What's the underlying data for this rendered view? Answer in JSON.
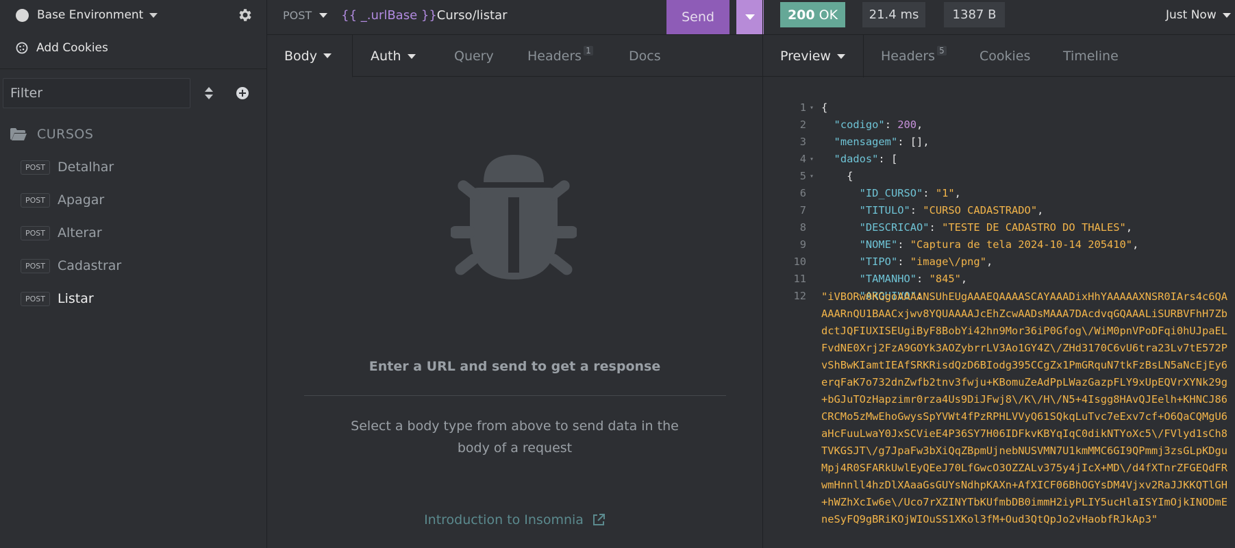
{
  "sidebar": {
    "environment_label": "Base Environment",
    "add_cookies_label": "Add Cookies",
    "filter_placeholder": "Filter",
    "folder_label": "CURSOS",
    "items": [
      {
        "method": "POST",
        "label": "Detalhar"
      },
      {
        "method": "POST",
        "label": "Apagar"
      },
      {
        "method": "POST",
        "label": "Alterar"
      },
      {
        "method": "POST",
        "label": "Cadastrar"
      },
      {
        "method": "POST",
        "label": "Listar",
        "active": true
      }
    ]
  },
  "request": {
    "method": "POST",
    "url_tag": "{{ _.urlBase }}",
    "url_path": "Curso/listar",
    "send_label": "Send",
    "tabs": {
      "body": "Body",
      "auth": "Auth",
      "query": "Query",
      "headers": "Headers",
      "headers_count": "1",
      "docs": "Docs"
    },
    "empty_title": "Enter a URL and send to get a response",
    "empty_desc": "Select a body type from above to send data in the body of a request",
    "intro_link": "Introduction to Insomnia"
  },
  "response": {
    "status_code": "200",
    "status_text": "OK",
    "time": "21.4 ms",
    "size": "1387 B",
    "timestamp": "Just Now",
    "tabs": {
      "preview": "Preview",
      "headers": "Headers",
      "headers_count": "5",
      "cookies": "Cookies",
      "timeline": "Timeline"
    },
    "json": {
      "codigo_key": "\"codigo\"",
      "codigo_val": "200",
      "mensagem_key": "\"mensagem\"",
      "mensagem_val": "[]",
      "dados_key": "\"dados\"",
      "id_curso_key": "\"ID_CURSO\"",
      "id_curso_val": "\"1\"",
      "titulo_key": "\"TITULO\"",
      "titulo_val": "\"CURSO CADASTRADO\"",
      "descricao_key": "\"DESCRICAO\"",
      "descricao_val": "\"TESTE DE CADASTRO DO THALES\"",
      "nome_key": "\"NOME\"",
      "nome_val": "\"Captura de tela 2024-10-14 205410\"",
      "tipo_key": "\"TIPO\"",
      "tipo_val": "\"image\\/png\"",
      "tamanho_key": "\"TAMANHO\"",
      "tamanho_val": "\"845\"",
      "arquivo_key": "\"ARQUIVO\"",
      "arquivo_val": "\"iVBORw0KGgoAAAANSUhEUgAAAEQAAAASCAYAAADixHhYAAAAAXNSR0IArs4c6QAAAARnQU1BAACxjwv8YQUAAAAJcEhZcwAADsMAAA7DAcdvqGQAAALiSURBVFhH7ZbdctJQFIUXISEUgiByF8BobYi42hn9Mor36iP0Gfog\\/WiM0pnVPoDFqi0hUJpaELFvdNE0Xrj2FzA9GOYk3AOZybrrLV3Ao1GY4Z\\/ZHd3170C6vU6tra23Lv7tE572PvShBwKIamtIEAfSRKRisdQzD6BIodg395CCgZx1PmGRquN7tkFzBsLN5aNcEjEy6erqFaK7o732dnZwfb2tnv3fwju+KBomuZeAdPpLWazGazpFLY9xUpEQVrXYNk29g+bGJuTOzHapzimr0rza4Us9DiJFwj8\\/K\\/H\\/N5+4Isgg8HAvQJEelh+KHNCJ86CRCMo5zMwEhoGwysSpYVWt4fPzRPHLVVyQ61SQkqLuTvc7eExv7cf+O6QaCQMgU6aHcFuuLwaY0JxSCVieE4P36SY7H06IDFkvKBYqIqC0dikNTYoXc5\\/FVlyd1sCh8TVKGSJT\\/g7JpaFw3bXiQqZBpmUjnebNUSVMN7U1kmMMC6GI9QPmmj3zsGLpKDguMpj4R0SFARkUwlEyQEeJ70LfGwcO3OZZALv375y4jIcX+MD\\/d4fXTnrZFGEQdFRwmHnnll4hzDlXAaaGsGUYsNdhpKAXn+AfXICF06BhOGYsDM4Vjxv2RaJJKKQTlGH+hWZhXcIw6e\\/Uco7rXZINYTbKUfmbDB0immH2iyPLIY5ucHlaISYImOjkINODmEneSyFQ9gBRiKOjWIOuSS1XKol3fM+Oud3QtQpJo2vHaobfRJkAp3\""
    }
  }
}
